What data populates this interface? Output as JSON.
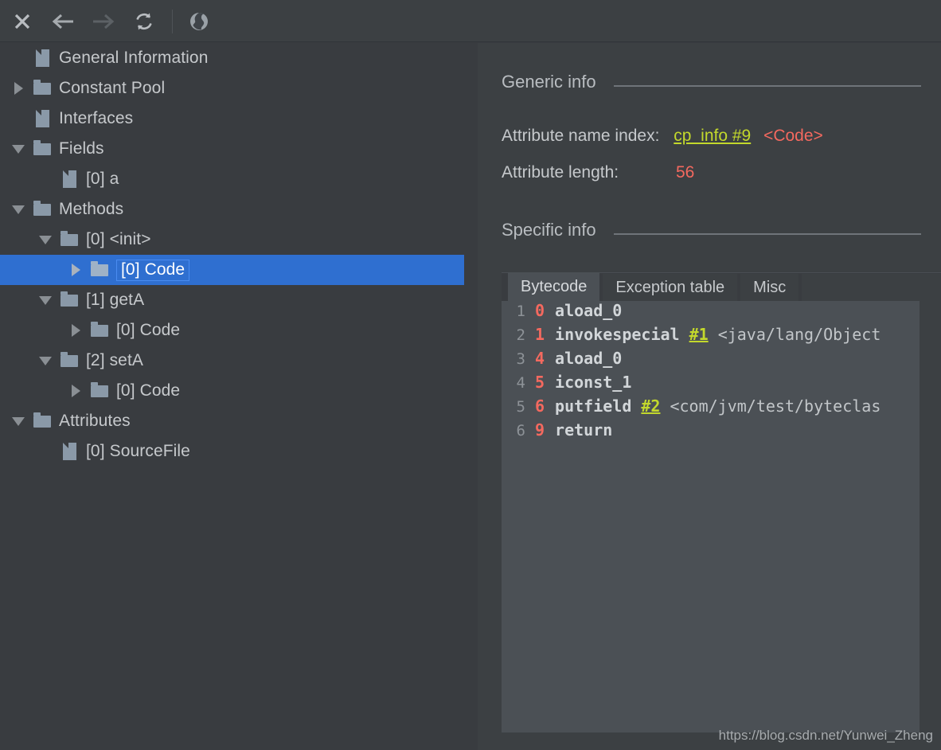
{
  "toolbar": {
    "buttons": [
      {
        "name": "close-icon",
        "label": "Close"
      },
      {
        "name": "back-arrow-icon",
        "label": "Back"
      },
      {
        "name": "forward-arrow-icon",
        "label": "Forward"
      },
      {
        "name": "reload-icon",
        "label": "Reload"
      },
      {
        "name": "globe-icon",
        "label": "Browse"
      }
    ]
  },
  "tree": {
    "items": [
      {
        "label": "General Information",
        "indent": 0,
        "icon": "file",
        "toggle": "none",
        "selected": false
      },
      {
        "label": "Constant Pool",
        "indent": 0,
        "icon": "folder",
        "toggle": "collapsed",
        "selected": false
      },
      {
        "label": "Interfaces",
        "indent": 0,
        "icon": "file",
        "toggle": "none",
        "selected": false
      },
      {
        "label": "Fields",
        "indent": 0,
        "icon": "folder",
        "toggle": "expanded",
        "selected": false
      },
      {
        "label": "[0] a",
        "indent": 1,
        "icon": "file",
        "toggle": "none",
        "selected": false
      },
      {
        "label": "Methods",
        "indent": 0,
        "icon": "folder",
        "toggle": "expanded",
        "selected": false
      },
      {
        "label": "[0] <init>",
        "indent": 1,
        "icon": "folder",
        "toggle": "expanded",
        "selected": false
      },
      {
        "label": "[0] Code",
        "indent": 2,
        "icon": "folder",
        "toggle": "collapsed",
        "selected": true
      },
      {
        "label": "[1] getA",
        "indent": 1,
        "icon": "folder",
        "toggle": "expanded",
        "selected": false
      },
      {
        "label": "[0] Code",
        "indent": 2,
        "icon": "folder",
        "toggle": "collapsed",
        "selected": false
      },
      {
        "label": "[2] setA",
        "indent": 1,
        "icon": "folder",
        "toggle": "expanded",
        "selected": false
      },
      {
        "label": "[0] Code",
        "indent": 2,
        "icon": "folder",
        "toggle": "collapsed",
        "selected": false
      },
      {
        "label": "Attributes",
        "indent": 0,
        "icon": "folder",
        "toggle": "expanded",
        "selected": false
      },
      {
        "label": "[0] SourceFile",
        "indent": 1,
        "icon": "file",
        "toggle": "none",
        "selected": false
      }
    ]
  },
  "detail": {
    "generic_info_title": "Generic info",
    "attribute_name_index_label": "Attribute name index:",
    "attribute_name_index_link": "cp_info #9",
    "attribute_name_index_value": "<Code>",
    "attribute_length_label": "Attribute length:",
    "attribute_length_value": "56",
    "specific_info_title": "Specific info",
    "tabs": [
      {
        "label": "Bytecode",
        "active": true
      },
      {
        "label": "Exception table",
        "active": false
      },
      {
        "label": "Misc",
        "active": false
      }
    ],
    "bytecode": [
      {
        "line": "1",
        "offset": "0",
        "opcode": "aload_0",
        "cpref": "",
        "comment": ""
      },
      {
        "line": "2",
        "offset": "1",
        "opcode": "invokespecial",
        "cpref": "#1",
        "comment": "<java/lang/Object"
      },
      {
        "line": "3",
        "offset": "4",
        "opcode": "aload_0",
        "cpref": "",
        "comment": ""
      },
      {
        "line": "4",
        "offset": "5",
        "opcode": "iconst_1",
        "cpref": "",
        "comment": ""
      },
      {
        "line": "5",
        "offset": "6",
        "opcode": "putfield",
        "cpref": "#2",
        "comment": "<com/jvm/test/byteclas"
      },
      {
        "line": "6",
        "offset": "9",
        "opcode": "return",
        "cpref": "",
        "comment": ""
      }
    ]
  },
  "watermark": "https://blog.csdn.net/Yunwei_Zheng",
  "colors": {
    "toolbar_bg": "#3c4043",
    "tree_bg": "#393c40",
    "detail_bg": "#3c4043",
    "code_bg": "#4b5055",
    "selection_blue": "#2f6fd0",
    "link_green": "#c3d82c",
    "value_red": "#f4695f",
    "text_gray": "#c6c9cc",
    "icon_gray": "#8a99a8"
  }
}
